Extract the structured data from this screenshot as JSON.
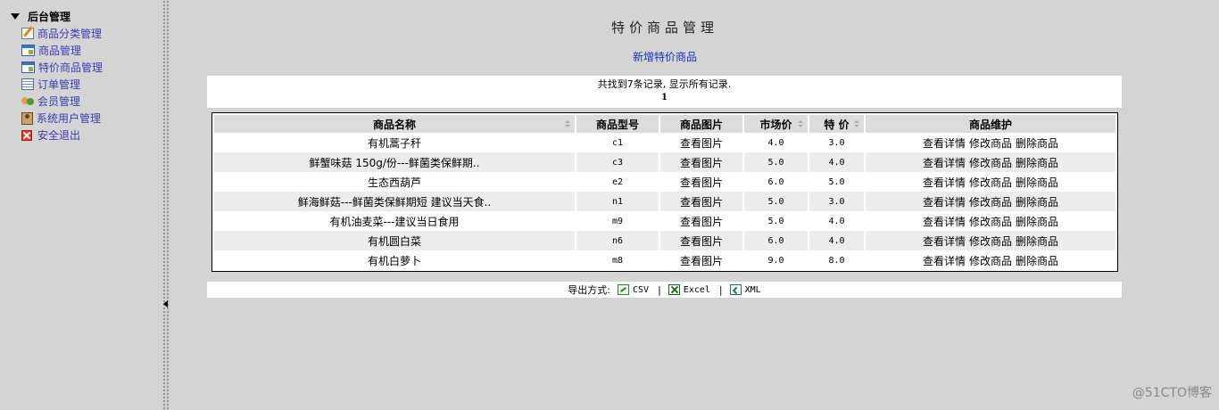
{
  "sidebar": {
    "root_label": "后台管理",
    "items": [
      {
        "label": "商品分类管理",
        "icon": "edit-icon"
      },
      {
        "label": "商品管理",
        "icon": "window-icon"
      },
      {
        "label": "特价商品管理",
        "icon": "window-icon"
      },
      {
        "label": "订单管理",
        "icon": "list-icon"
      },
      {
        "label": "会员管理",
        "icon": "users-icon"
      },
      {
        "label": "系统用户管理",
        "icon": "admin-user-icon"
      },
      {
        "label": "安全退出",
        "icon": "exit-icon"
      }
    ]
  },
  "main": {
    "title": "特价商品管理",
    "add_link": "新增特价商品",
    "info": {
      "summary": "共找到7条记录, 显示所有记录.",
      "page": "1"
    },
    "table": {
      "headers": [
        "商品名称",
        "商品型号",
        "商品图片",
        "市场价",
        "特 价",
        "商品维护"
      ],
      "rows": [
        {
          "name": "有机蒿子秆",
          "model": "c1",
          "image": "查看图片",
          "market_price": "4.0",
          "special_price": "3.0"
        },
        {
          "name": "鲜蟹味菇 150g/份---鲜菌类保鲜期..",
          "model": "c3",
          "image": "查看图片",
          "market_price": "5.0",
          "special_price": "4.0"
        },
        {
          "name": "生态西葫芦",
          "model": "e2",
          "image": "查看图片",
          "market_price": "6.0",
          "special_price": "5.0"
        },
        {
          "name": "鲜海鲜菇---鲜菌类保鲜期短 建议当天食..",
          "model": "n1",
          "image": "查看图片",
          "market_price": "5.0",
          "special_price": "3.0"
        },
        {
          "name": "有机油麦菜---建议当日食用",
          "model": "m9",
          "image": "查看图片",
          "market_price": "5.0",
          "special_price": "4.0"
        },
        {
          "name": "有机圆白菜",
          "model": "n6",
          "image": "查看图片",
          "market_price": "6.0",
          "special_price": "4.0"
        },
        {
          "name": "有机白萝卜",
          "model": "m8",
          "image": "查看图片",
          "market_price": "9.0",
          "special_price": "8.0"
        }
      ],
      "actions": [
        "查看详情",
        "修改商品",
        "删除商品"
      ]
    },
    "export": {
      "label": "导出方式:",
      "separator": "|",
      "csv": "CSV",
      "excel": "Excel",
      "xml": "XML"
    }
  },
  "watermark": "@51CTO博客",
  "colors": {
    "background": "#d4d4d4",
    "link": "#1a2fbf",
    "nav_link": "#3b3bb5",
    "header_bg": "#dcdcdc",
    "alt_row": "#ececec"
  }
}
